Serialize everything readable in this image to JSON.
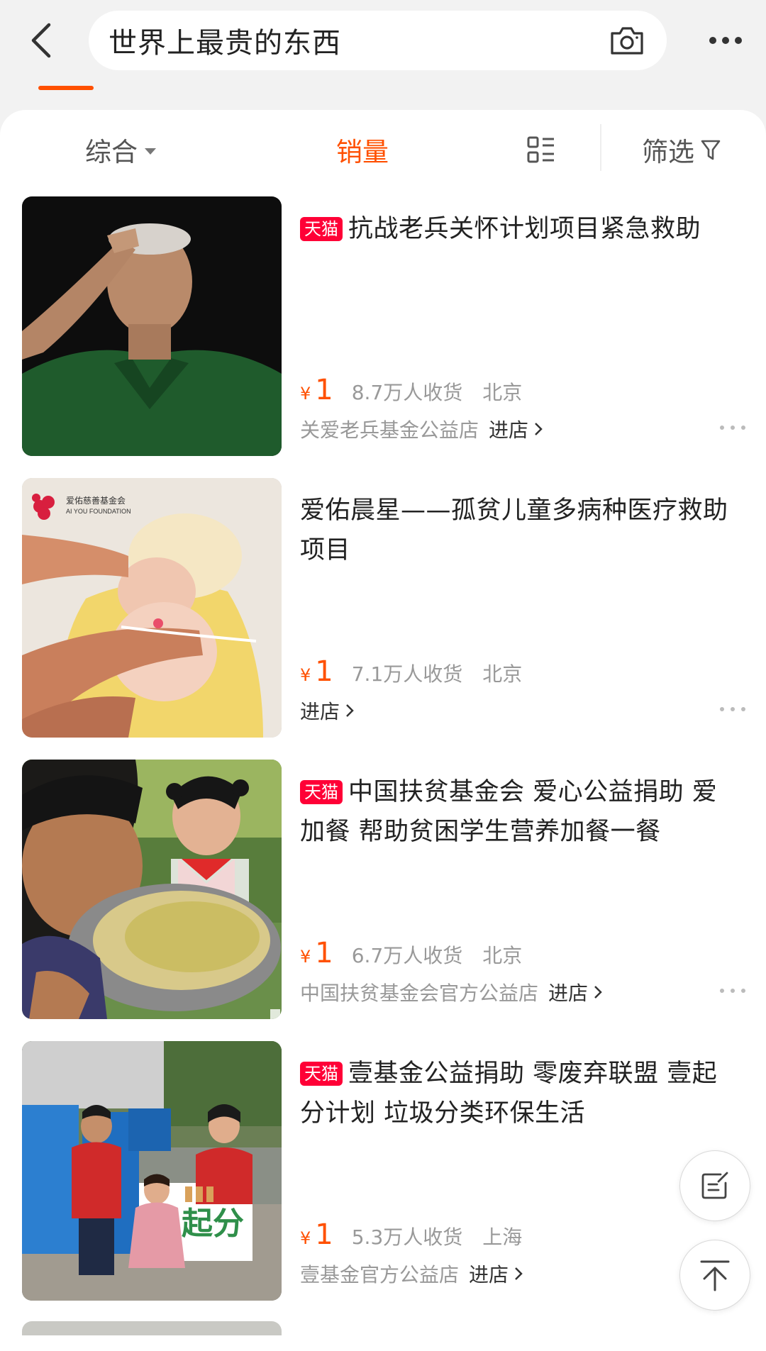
{
  "search": {
    "query": "世界上最贵的东西"
  },
  "sort_bar": {
    "comprehensive": "综合",
    "sales": "销量",
    "filter": "筛选"
  },
  "tmall_badge": "天猫",
  "currency_symbol": "¥",
  "enter_shop_label": "进店",
  "products": [
    {
      "title": "抗战老兵关怀计划项目紧急救助",
      "tmall": true,
      "price": "1",
      "sold": "8.7万人收货",
      "location": "北京",
      "shop": "关爱老兵基金公益店"
    },
    {
      "title": "爱佑晨星——孤贫儿童多病种医疗救助项目",
      "tmall": false,
      "price": "1",
      "sold": "7.1万人收货",
      "location": "北京",
      "shop": "",
      "image_text": [
        "爱佑慈善基金会",
        "AI YOU FOUNDATION"
      ]
    },
    {
      "title": "中国扶贫基金会 爱心公益捐助 爱加餐 帮助贫困学生营养加餐一餐",
      "tmall": true,
      "price": "1",
      "sold": "6.7万人收货",
      "location": "北京",
      "shop": "中国扶贫基金会官方公益店"
    },
    {
      "title": "壹基金公益捐助 零废弃联盟 壹起分计划 垃圾分类环保生活",
      "tmall": true,
      "price": "1",
      "sold": "5.3万人收货",
      "location": "上海",
      "shop": "壹基金官方公益店",
      "image_text": [
        "起分"
      ]
    }
  ],
  "colors": {
    "accent": "#ff5000",
    "tmall": "#ff0036",
    "muted": "#999999"
  },
  "icons": [
    "back-arrow-icon",
    "camera-icon",
    "more-icon",
    "caret-down-icon",
    "grid-list-icon",
    "filter-funnel-icon",
    "chevron-right-icon",
    "feedback-edit-icon",
    "back-to-top-icon"
  ]
}
